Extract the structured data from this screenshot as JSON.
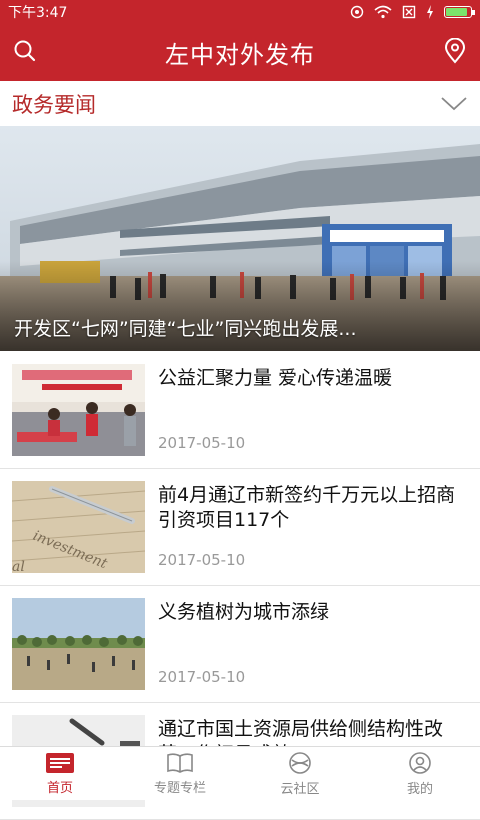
{
  "status_bar": {
    "time": "下午3:47"
  },
  "header": {
    "title": "左中对外发布",
    "search_icon": "search-icon",
    "location_icon": "location-pin-icon"
  },
  "section": {
    "title": "政务要闻",
    "toggle_icon": "chevron-down-icon"
  },
  "hero": {
    "caption": "开发区“七网”同建“七业”同兴跑出发展..."
  },
  "news": [
    {
      "title": "公益汇聚力量 爱心传递温暖",
      "date": "2017-05-10"
    },
    {
      "title": "前4月通辽市新签约千万元以上招商引资项目117个",
      "date": "2017-05-10"
    },
    {
      "title": "义务植树为城市添绿",
      "date": "2017-05-10"
    },
    {
      "title": "通辽市国土资源局供给侧结构性改革工作初见成效",
      "date": ""
    }
  ],
  "tabs": [
    {
      "label": "首页",
      "icon": "home-news-icon"
    },
    {
      "label": "专题专栏",
      "icon": "book-icon"
    },
    {
      "label": "云社区",
      "icon": "community-icon"
    },
    {
      "label": "我的",
      "icon": "user-icon"
    }
  ],
  "colors": {
    "brand": "#c4252c",
    "section_title": "#b52a2a",
    "date": "#999999"
  }
}
